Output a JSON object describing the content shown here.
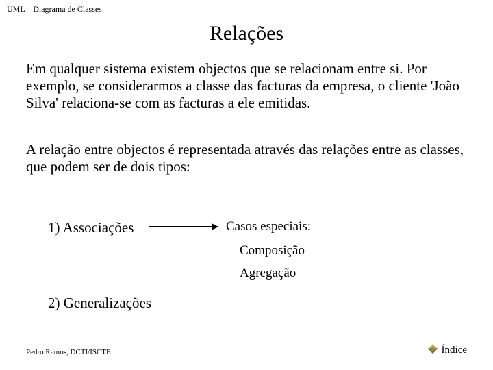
{
  "header": "UML – Diagrama de Classes",
  "title": "Relações",
  "para1": "Em qualquer sistema existem objectos que se relacionam entre si. Por exemplo, se considerarmos a classe das facturas da empresa, o cliente 'João Silva' relaciona-se com as facturas a ele emitidas.",
  "para2": "A relação entre objectos é representada através das relações entre as classes, que podem ser de dois tipos:",
  "item1": "1) Associações",
  "item2": "2) Generalizações",
  "special_label": "Casos especiais:",
  "special_a": "Composição",
  "special_b": "Agregação",
  "footer_left": "Pedro Ramos, DCTI/ISCTE",
  "footer_right": "Índice"
}
